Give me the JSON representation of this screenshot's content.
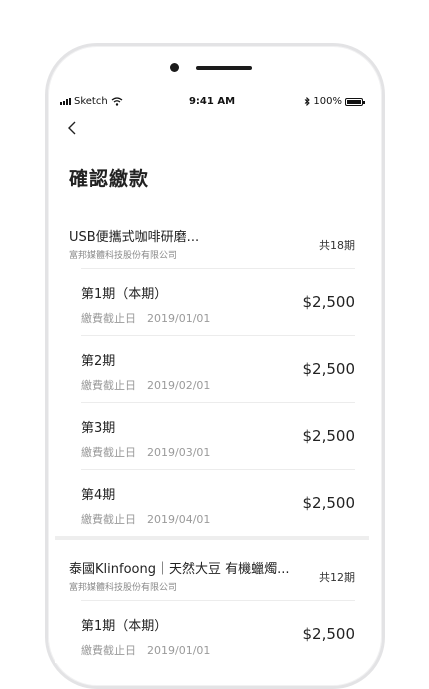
{
  "status_bar": {
    "carrier": "Sketch",
    "time": "9:41 AM",
    "battery": "100%"
  },
  "page": {
    "title": "確認繳款"
  },
  "orders": [
    {
      "product": "USB便攜式咖啡研磨...",
      "company": "富邦媒體科技股份有限公司",
      "total": "共18期",
      "installments": [
        {
          "period": "第1期（本期）",
          "due_label": "繳費截止日",
          "due_date": "2019/01/01",
          "amount": "$2,500"
        },
        {
          "period": "第2期",
          "due_label": "繳費截止日",
          "due_date": "2019/02/01",
          "amount": "$2,500"
        },
        {
          "period": "第3期",
          "due_label": "繳費截止日",
          "due_date": "2019/03/01",
          "amount": "$2,500"
        },
        {
          "period": "第4期",
          "due_label": "繳費截止日",
          "due_date": "2019/04/01",
          "amount": "$2,500"
        }
      ]
    },
    {
      "product": "泰國Klinfoong｜天然大豆 有機蠟燭...",
      "company": "富邦媒體科技股份有限公司",
      "total": "共12期",
      "installments": [
        {
          "period": "第1期（本期）",
          "due_label": "繳費截止日",
          "due_date": "2019/01/01",
          "amount": "$2,500"
        }
      ]
    }
  ],
  "icons": [
    "signal-icon",
    "wifi-icon",
    "bluetooth-icon",
    "battery-icon",
    "back-chevron-icon"
  ]
}
